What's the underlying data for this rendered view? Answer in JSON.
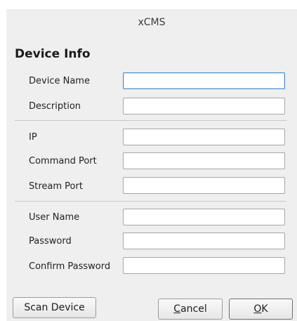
{
  "window": {
    "title": "xCMS"
  },
  "section": {
    "title": "Device Info"
  },
  "fields": {
    "device_name": {
      "label": "Device Name",
      "value": ""
    },
    "description": {
      "label": "Description",
      "value": ""
    },
    "ip": {
      "label": "IP",
      "value": ""
    },
    "command_port": {
      "label": "Command Port",
      "value": ""
    },
    "stream_port": {
      "label": "Stream Port",
      "value": ""
    },
    "user_name": {
      "label": "User Name",
      "value": ""
    },
    "password": {
      "label": "Password",
      "value": ""
    },
    "confirm_password": {
      "label": "Confirm Password",
      "value": ""
    }
  },
  "buttons": {
    "scan": "Scan Device",
    "cancel_mnemonic": "C",
    "cancel_rest": "ancel",
    "ok_mnemonic": "O",
    "ok_rest": "K"
  },
  "colors": {
    "background": "#efefef",
    "focus": "#4a90d9"
  }
}
